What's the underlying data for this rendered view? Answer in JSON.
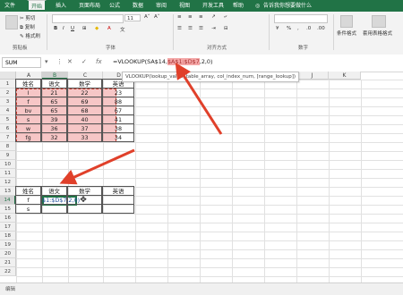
{
  "ribbon": {
    "tabs": [
      "文件",
      "开始",
      "插入",
      "页面布局",
      "公式",
      "数据",
      "审阅",
      "视图",
      "开发工具",
      "帮助"
    ],
    "tell_me": "告诉我你想要做什么",
    "clipboard": {
      "cut": "剪切",
      "copy": "复制",
      "format_painter": "格式刷",
      "label": "剪贴板"
    },
    "font": {
      "size": "11",
      "label": "字体"
    },
    "alignment_label": "对齐方式",
    "number_label": "数字",
    "styles": {
      "cond_format": "条件格式",
      "table_format": "套用表格格式"
    }
  },
  "formula_bar": {
    "name_box": "SUM",
    "fx": "fx",
    "formula_prefix": "=VLOOKUP(SA$14,",
    "formula_highlight": "$A$1:$D$7",
    "formula_suffix": ",2,0)"
  },
  "tooltip": {
    "text": "VLOOKUP(lookup_value, table_array, col_index_num, [range_lookup])"
  },
  "columns": [
    "A",
    "B",
    "C",
    "D",
    "E",
    "F",
    "G",
    "H",
    "I",
    "J",
    "K"
  ],
  "rows": [
    "1",
    "2",
    "3",
    "4",
    "5",
    "6",
    "7",
    "8",
    "9",
    "10",
    "11",
    "12",
    "13",
    "14",
    "15",
    "16",
    "17",
    "18",
    "19",
    "20",
    "21",
    "22"
  ],
  "table1": {
    "headers": [
      "姓名",
      "语文",
      "数学",
      "英语"
    ],
    "rows": [
      [
        "l",
        "21",
        "22",
        "23"
      ],
      [
        "f",
        "65",
        "69",
        "88"
      ],
      [
        "bv",
        "65",
        "68",
        "67"
      ],
      [
        "s",
        "39",
        "40",
        "41"
      ],
      [
        "w",
        "36",
        "37",
        "38"
      ],
      [
        "fg",
        "32",
        "33",
        "34"
      ]
    ]
  },
  "table2": {
    "headers": [
      "姓名",
      "语文",
      "数学",
      "英语"
    ],
    "rows": [
      [
        "f",
        "$1:$D$7,2,0)",
        "",
        ""
      ],
      [
        "s",
        "",
        "",
        ""
      ]
    ]
  },
  "status": {
    "mode": "编辑"
  },
  "colors": {
    "excel_green": "#217346",
    "arrow_red": "#e0402a"
  }
}
